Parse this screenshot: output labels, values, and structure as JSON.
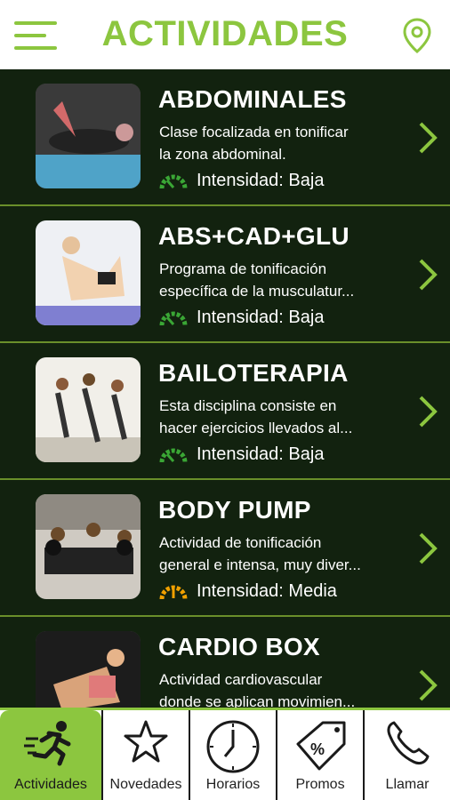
{
  "header": {
    "title": "ACTIVIDADES",
    "menu_icon": "hamburger-menu-icon",
    "location_icon": "map-pin-icon"
  },
  "colors": {
    "accent": "#8cc63f",
    "list_bg": "#12220f",
    "divider": "#6a8f2a",
    "gauge_low": "#3aa635",
    "gauge_medium": "#f0a000"
  },
  "activities": [
    {
      "title": "ABDOMINALES",
      "desc_line1": "Clase focalizada en tonificar",
      "desc_line2": "la zona abdominal.",
      "intensity": "Intensidad: Baja",
      "level": "low"
    },
    {
      "title": "ABS+CAD+GLU",
      "desc_line1": "Programa de tonificación",
      "desc_line2": "específica de la musculatur...",
      "intensity": "Intensidad: Baja",
      "level": "low"
    },
    {
      "title": "BAILOTERAPIA",
      "desc_line1": "Esta disciplina consiste en",
      "desc_line2": "hacer ejercicios llevados al...",
      "intensity": "Intensidad: Baja",
      "level": "low"
    },
    {
      "title": "BODY PUMP",
      "desc_line1": "Actividad de tonificación",
      "desc_line2": "general e intensa, muy diver...",
      "intensity": "Intensidad: Media",
      "level": "medium"
    },
    {
      "title": "CARDIO BOX",
      "desc_line1": "Actividad cardiovascular",
      "desc_line2": "donde se aplican movimien...",
      "intensity": "",
      "level": ""
    }
  ],
  "tabs": [
    {
      "label": "Actividades",
      "icon": "running-person-icon",
      "active": true
    },
    {
      "label": "Novedades",
      "icon": "star-icon",
      "active": false
    },
    {
      "label": "Horarios",
      "icon": "clock-icon",
      "active": false
    },
    {
      "label": "Promos",
      "icon": "price-tag-icon",
      "active": false
    },
    {
      "label": "Llamar",
      "icon": "phone-icon",
      "active": false
    }
  ]
}
